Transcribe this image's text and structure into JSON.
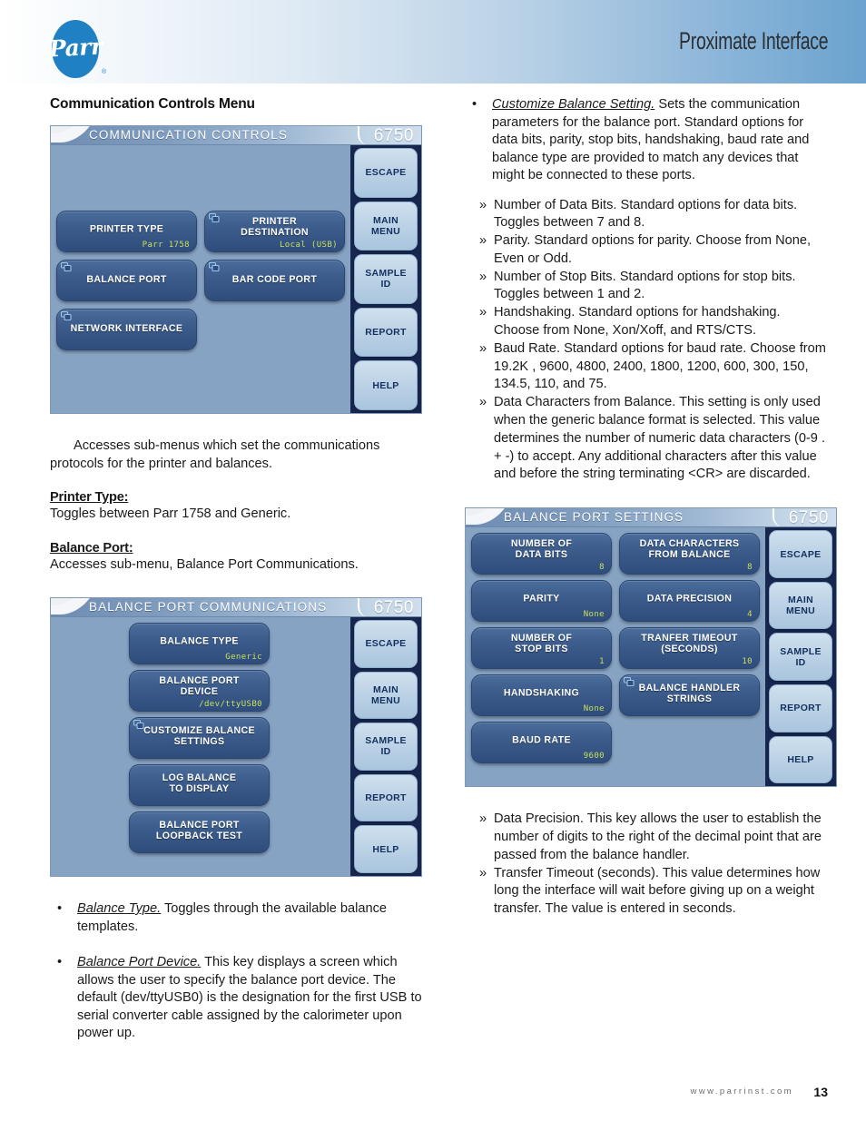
{
  "header": {
    "title": "Proximate Interface",
    "logo_text": "Parr"
  },
  "left_column": {
    "section_title": "Communication Controls Menu",
    "intro_paragraph": "Accesses sub-menus which set the communications protocols for the printer and balances.",
    "printer_type_head": "Printer Type:",
    "printer_type_body": "Toggles between Parr 1758 and Generic.",
    "balance_port_head": "Balance Port:",
    "balance_port_body": "Accesses sub-menu, Balance Port Communications.",
    "bullets": [
      {
        "mark": "•",
        "term": "Balance Type.",
        "text": " Toggles through the available balance templates."
      },
      {
        "mark": "•",
        "term": "Balance Port Device.",
        "text": " This key displays a screen which allows the user to specify the balance port device. The default (dev/ttyUSB0) is the designation for the first USB to serial converter cable assigned by the calorimeter upon power up."
      }
    ]
  },
  "right_column": {
    "bullets": [
      {
        "mark": "•",
        "term": "Customize Balance Setting.",
        "text": "  Sets the communication parameters for the balance port.  Standard options for data bits, parity, stop bits, handshaking, baud rate and balance type are provided to match any devices that might be connected to these ports."
      }
    ],
    "sub_items_top": [
      {
        "mark": "»",
        "text": "Number of Data Bits. Standard options for data bits. Toggles between 7 and 8."
      },
      {
        "mark": "»",
        "text": "Parity. Standard options for parity. Choose from None, Even or Odd."
      },
      {
        "mark": "»",
        "text": "Number of Stop Bits. Standard options for stop bits. Toggles between 1 and 2."
      },
      {
        "mark": "»",
        "text": "Handshaking. Standard options for handshaking. Choose from None, Xon/Xoff, and RTS/CTS."
      },
      {
        "mark": "»",
        "text": "Baud Rate. Standard options for baud rate. Choose from 19.2K , 9600, 4800, 2400, 1800, 1200, 600, 300, 150, 134.5, 110, and 75."
      },
      {
        "mark": "»",
        "text": "Data Characters from Balance. This setting is only used when the generic balance format is selected. This value determines the number of numeric data characters (0-9 . + -) to accept.  Any additional characters after this value and before the string terminating <CR> are discarded."
      }
    ],
    "sub_items_bottom": [
      {
        "mark": "»",
        "text": "Data Precision. This key allows the user to establish the number of digits to the right of the decimal point that are passed from the balance handler."
      },
      {
        "mark": "»",
        "text": "Transfer Timeout (seconds). This value determines how long the interface will wait before giving up on a weight transfer.  The value is entered in seconds."
      }
    ]
  },
  "screens": [
    {
      "id": "communication-controls",
      "title": "COMMUNICATION CONTROLS",
      "model": "6750",
      "side_buttons": [
        "ESCAPE",
        "MAIN\nMENU",
        "SAMPLE\nID",
        "REPORT",
        "HELP"
      ],
      "main_buttons": [
        {
          "label": "PRINTER TYPE",
          "value": "Parr 1758",
          "link": false
        },
        {
          "label": "PRINTER\nDESTINATION",
          "value": "Local (USB)",
          "link": true
        },
        {
          "label": "BALANCE PORT",
          "value": "",
          "link": true
        },
        {
          "label": "BAR CODE PORT",
          "value": "",
          "link": true
        },
        {
          "label": "NETWORK INTERFACE",
          "value": "",
          "link": true
        }
      ]
    },
    {
      "id": "balance-port-communications",
      "title": "BALANCE PORT COMMUNICATIONS",
      "model": "6750",
      "side_buttons": [
        "ESCAPE",
        "MAIN\nMENU",
        "SAMPLE\nID",
        "REPORT",
        "HELP"
      ],
      "main_buttons": [
        {
          "label": "BALANCE TYPE",
          "value": "Generic",
          "link": false
        },
        {
          "label": "BALANCE PORT\nDEVICE",
          "value": "/dev/ttyUSB0",
          "link": false
        },
        {
          "label": "CUSTOMIZE BALANCE\nSETTINGS",
          "value": "",
          "link": true
        },
        {
          "label": "LOG BALANCE\nTO DISPLAY",
          "value": "",
          "link": false
        },
        {
          "label": "BALANCE PORT\nLOOPBACK TEST",
          "value": "",
          "link": false
        }
      ]
    },
    {
      "id": "balance-port-settings",
      "title": "BALANCE PORT SETTINGS",
      "model": "6750",
      "side_buttons": [
        "ESCAPE",
        "MAIN\nMENU",
        "SAMPLE\nID",
        "REPORT",
        "HELP"
      ],
      "main_buttons": [
        {
          "label": "NUMBER OF\nDATA BITS",
          "value": "8",
          "link": false
        },
        {
          "label": "DATA CHARACTERS\nFROM BALANCE",
          "value": "8",
          "link": false
        },
        {
          "label": "PARITY",
          "value": "None",
          "link": false
        },
        {
          "label": "DATA PRECISION",
          "value": "4",
          "link": false
        },
        {
          "label": "NUMBER OF\nSTOP BITS",
          "value": "1",
          "link": false
        },
        {
          "label": "TRANFER TIMEOUT\n(SECONDS)",
          "value": "10",
          "link": false
        },
        {
          "label": "HANDSHAKING",
          "value": "None",
          "link": false
        },
        {
          "label": "BALANCE HANDLER\nSTRINGS",
          "value": "",
          "link": true
        },
        {
          "label": "BAUD RATE",
          "value": "9600",
          "link": false
        }
      ]
    }
  ],
  "footer": {
    "url": "www.parrinst.com",
    "page": "13"
  }
}
